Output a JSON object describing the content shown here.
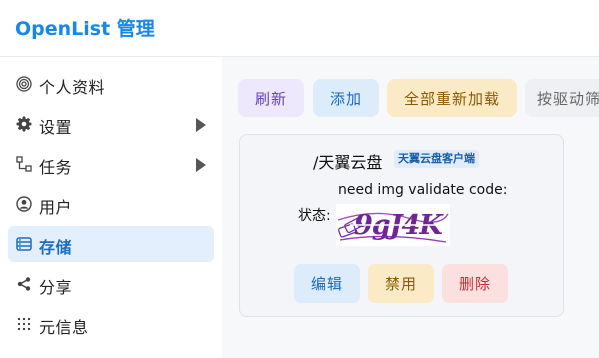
{
  "app": {
    "title": "OpenList 管理"
  },
  "sidebar": {
    "items": [
      {
        "label": "个人资料",
        "icon": "fingerprint-icon",
        "active": false
      },
      {
        "label": "设置",
        "icon": "gear-icon",
        "has_submenu": true,
        "active": false
      },
      {
        "label": "任务",
        "icon": "workflow-icon",
        "has_submenu": true,
        "active": false
      },
      {
        "label": "用户",
        "icon": "user-circle-icon",
        "active": false
      },
      {
        "label": "存储",
        "icon": "database-icon",
        "active": true
      },
      {
        "label": "分享",
        "icon": "share-icon",
        "active": false
      },
      {
        "label": "元信息",
        "icon": "metadata-icon",
        "active": false
      }
    ]
  },
  "toolbar": {
    "refresh_label": "刷新",
    "add_label": "添加",
    "reload_all_label": "全部重新加载",
    "filter_by_driver_label": "按驱动筛"
  },
  "storage": {
    "mount_path": "/天翼云盘",
    "driver_badge": "天翼云盘客户端",
    "status_label": "状态:",
    "status_message": "need img validate code:",
    "captcha_text": "9gJ4K",
    "edit_label": "编辑",
    "disable_label": "禁用",
    "delete_label": "删除"
  },
  "colors": {
    "brand": "#1688e8",
    "active_nav_bg": "#e3effc",
    "refresh_bg": "#ede8fb",
    "add_bg": "#dcecfb",
    "reload_bg": "#fbeac6",
    "filter_bg": "#eef0f3",
    "edit_bg": "#dcecfb",
    "disable_bg": "#fbeac6",
    "delete_bg": "#fbe0e0"
  }
}
